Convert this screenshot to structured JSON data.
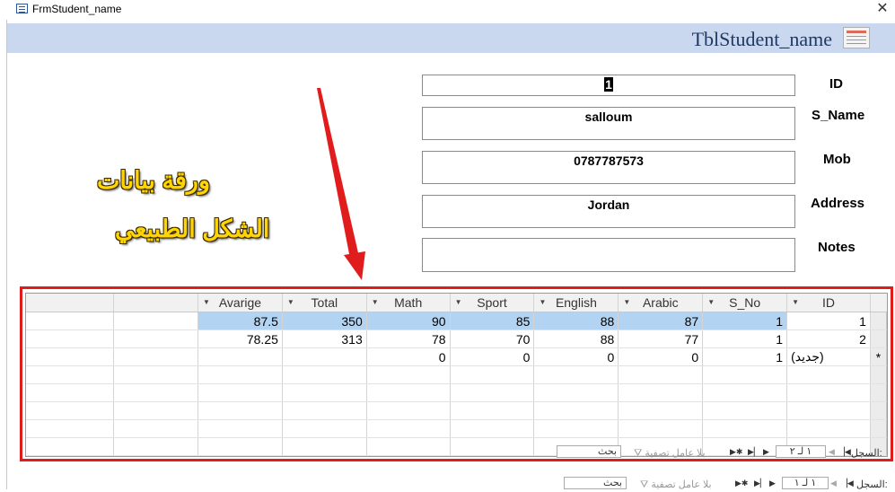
{
  "window": {
    "title": "FrmStudent_name",
    "close_glyph": "✕"
  },
  "form": {
    "heading": "TblStudent_name"
  },
  "fields": {
    "id": {
      "label": "ID",
      "value": "1"
    },
    "s_name": {
      "label": "S_Name",
      "value": "salloum"
    },
    "mob": {
      "label": "Mob",
      "value": "0787787573"
    },
    "address": {
      "label": "Address",
      "value": "Jordan"
    },
    "notes": {
      "label": "Notes",
      "value": ""
    }
  },
  "annotation": {
    "line1": "ورقة بيانات",
    "line2": "الشكل الطبيعي"
  },
  "colors": {
    "annotation_text": "#ffd400",
    "highlight_border": "#e01c1c",
    "arrow": "#e01c1c",
    "selected_row": "#b3d3f2",
    "header_band": "#c9d8ee"
  },
  "subform": {
    "columns": [
      "Avarige",
      "Total",
      "Math",
      "Sport",
      "English",
      "Arabic",
      "S_No",
      "ID"
    ],
    "rows": [
      [
        "87.5",
        "350",
        "90",
        "85",
        "88",
        "87",
        "1",
        "1"
      ],
      [
        "78.25",
        "313",
        "78",
        "70",
        "88",
        "77",
        "1",
        "2"
      ],
      [
        "",
        "",
        "0",
        "0",
        "0",
        "0",
        "1",
        "(جديد)"
      ]
    ],
    "new_row_marker": "*",
    "nav": {
      "record_label": "السجل:",
      "position": "١ لـ ٢",
      "no_filter": "بلا عامل تصفية",
      "search": "بحث"
    }
  },
  "mainnav": {
    "record_label": "السجل:",
    "position": "١ لـ ١",
    "no_filter": "بلا عامل تصفية",
    "search": "بحث"
  },
  "icons": {
    "app": "form-icon",
    "table": "table-icon",
    "close": "close-icon",
    "filter": "funnel-icon"
  }
}
